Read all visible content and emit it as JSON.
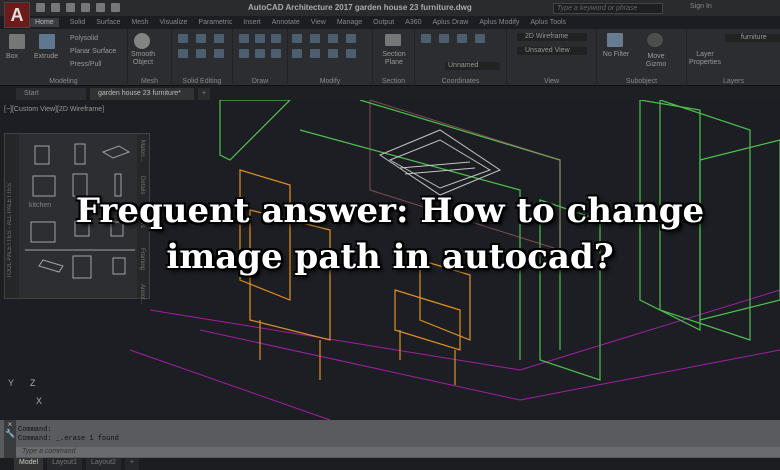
{
  "titlebar": {
    "logo": "A",
    "app_title": "AutoCAD Architecture 2017   garden house 23 furniture.dwg",
    "search_placeholder": "Type a keyword or phrase",
    "sign_in": "Sign In"
  },
  "ribbon_tabs": [
    "Home",
    "Solid",
    "Surface",
    "Mesh",
    "Visualize",
    "Parametric",
    "Insert",
    "Annotate",
    "View",
    "Manage",
    "Output",
    "A360",
    "Aplus Draw",
    "Aplus Modify",
    "Aplus Tools"
  ],
  "ribbon": {
    "modeling": {
      "label": "Modeling",
      "box": "Box",
      "extrude": "Extrude",
      "polysolid": "Polysolid",
      "planar": "Planar Surface",
      "presspull": "Press/Pull"
    },
    "mesh": {
      "label": "Mesh",
      "smooth": "Smooth Object"
    },
    "solid_editing": {
      "label": "Solid Editing"
    },
    "draw": {
      "label": "Draw"
    },
    "modify": {
      "label": "Modify"
    },
    "section": {
      "label": "Section",
      "plane": "Section Plane"
    },
    "coordinates": {
      "label": "Coordinates",
      "ucs": "Unnamed"
    },
    "view": {
      "label": "View",
      "style": "2D Wireframe",
      "saved": "Unsaved View"
    },
    "subobject": {
      "label": "Subobject",
      "filter": "No Filter",
      "gizmo": "Move Gizmo"
    },
    "layers": {
      "label": "Layers",
      "props": "Layer Properties",
      "current": "furniture"
    }
  },
  "doc_tabs": [
    "Start",
    "garden house 23 furniture*",
    "+"
  ],
  "viewport": {
    "label": "[−][Custom View][2D Wireframe]",
    "ucs_x": "X",
    "ucs_y": "Y",
    "ucs_z": "Z"
  },
  "palette": {
    "title": "TOOL PALETTES - ALL PALETTES",
    "group": "kitchen",
    "tabs": [
      "Materi...",
      "Details",
      "Doors",
      "Framing",
      "Annot..."
    ]
  },
  "overlay": {
    "line1": "Frequent answer: How to change",
    "line2": "image path in autocad?"
  },
  "command": {
    "line1": "Command:",
    "line2": "Command:  _.erase 1 found",
    "placeholder": "Type a command"
  },
  "layout_tabs": [
    "Model",
    "Layout1",
    "Layout2",
    "+"
  ]
}
